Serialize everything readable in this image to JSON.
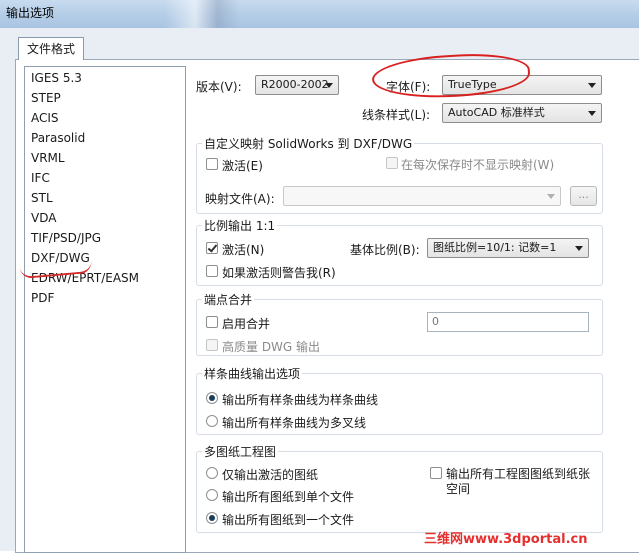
{
  "window": {
    "title": "输出选项"
  },
  "tab": {
    "label": "文件格式"
  },
  "formats": [
    "IGES 5.3",
    "STEP",
    "ACIS",
    "Parasolid",
    "VRML",
    "IFC",
    "STL",
    "VDA",
    "TIF/PSD/JPG",
    "DXF/DWG",
    "EDRW/EPRT/EASM",
    "PDF"
  ],
  "selected_format": "DXF/DWG",
  "version": {
    "label": "版本(V):",
    "value": "R2000-2002"
  },
  "font": {
    "label": "字体(F):",
    "value": "TrueType"
  },
  "linestyle": {
    "label": "线条样式(L):",
    "value": "AutoCAD 标准样式"
  },
  "custom_map": {
    "title": "自定义映射 SolidWorks 到 DXF/DWG",
    "activate_label": "激活(E)",
    "activate_checked": false,
    "no_show_label": "在每次保存时不显示映射(W)",
    "no_show_checked": false,
    "map_file_label": "映射文件(A):",
    "map_file_value": "",
    "browse_label": "..."
  },
  "scale_output": {
    "title": "比例输出 1:1",
    "activate_label": "激活(N)",
    "activate_checked": true,
    "base_scale_label": "基体比例(B):",
    "base_scale_value": "图纸比例=10/1: 记数=1",
    "warn_label": "如果激活则警告我(R)",
    "warn_checked": false
  },
  "endpoint_merge": {
    "title": "端点合并",
    "enable_label": "启用合并",
    "enable_checked": false,
    "tolerance_value": "0",
    "hq_label": "高质量 DWG 输出",
    "hq_checked": false
  },
  "spline_options": {
    "title": "样条曲线输出选项",
    "opt1_label": "输出所有样条曲线为样条曲线",
    "opt2_label": "输出所有样条曲线为多叉线",
    "selected": 1
  },
  "multi_sheet": {
    "title": "多图纸工程图",
    "opt1_label": "仅输出激活的图纸",
    "opt2_label": "输出所有图纸到单个文件",
    "opt3_label": "输出所有图纸到一个文件",
    "selected": 3,
    "paper_space_label_line1": "输出所有工程图图纸到纸张",
    "paper_space_label_line2": "空间",
    "paper_space_checked": false
  },
  "watermark": {
    "text": "三维网www.3dportal.cn"
  },
  "colors": {
    "annotation_red": "#d92020",
    "watermark_red": "#e53030"
  }
}
